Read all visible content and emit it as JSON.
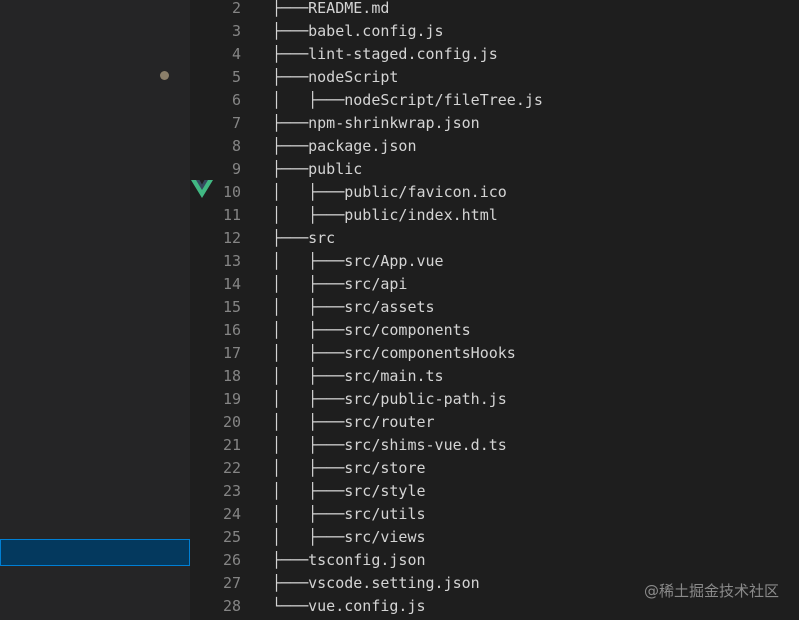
{
  "editor": {
    "lines": [
      {
        "number": "2",
        "text": "├───README.md"
      },
      {
        "number": "3",
        "text": "├───babel.config.js"
      },
      {
        "number": "4",
        "text": "├───lint-staged.config.js"
      },
      {
        "number": "5",
        "text": "├───nodeScript"
      },
      {
        "number": "6",
        "text": "│   ├───nodeScript/fileTree.js"
      },
      {
        "number": "7",
        "text": "├───npm-shrinkwrap.json"
      },
      {
        "number": "8",
        "text": "├───package.json"
      },
      {
        "number": "9",
        "text": "├───public"
      },
      {
        "number": "10",
        "text": "│   ├───public/favicon.ico"
      },
      {
        "number": "11",
        "text": "│   ├───public/index.html"
      },
      {
        "number": "12",
        "text": "├───src"
      },
      {
        "number": "13",
        "text": "│   ├───src/App.vue"
      },
      {
        "number": "14",
        "text": "│   ├───src/api"
      },
      {
        "number": "15",
        "text": "│   ├───src/assets"
      },
      {
        "number": "16",
        "text": "│   ├───src/components"
      },
      {
        "number": "17",
        "text": "│   ├───src/componentsHooks"
      },
      {
        "number": "18",
        "text": "│   ├───src/main.ts"
      },
      {
        "number": "19",
        "text": "│   ├───src/public-path.js"
      },
      {
        "number": "20",
        "text": "│   ├───src/router"
      },
      {
        "number": "21",
        "text": "│   ├───src/shims-vue.d.ts"
      },
      {
        "number": "22",
        "text": "│   ├───src/store"
      },
      {
        "number": "23",
        "text": "│   ├───src/style"
      },
      {
        "number": "24",
        "text": "│   ├───src/utils"
      },
      {
        "number": "25",
        "text": "│   ├───src/views"
      },
      {
        "number": "26",
        "text": "├───tsconfig.json"
      },
      {
        "number": "27",
        "text": "├───vscode.setting.json"
      },
      {
        "number": "28",
        "text": "└───vue.config.js"
      }
    ],
    "gutter_icon": "vue-logo-icon"
  },
  "watermark": "@稀土掘金技术社区",
  "colors": {
    "sidebar_bg": "#252526",
    "editor_bg": "#1e1e1e",
    "selection_bg": "#04395e",
    "selection_border": "#007fd4",
    "line_number": "#858585",
    "code_text": "#d4d4d4",
    "vue_green": "#41b883",
    "vue_dark": "#35495e"
  }
}
